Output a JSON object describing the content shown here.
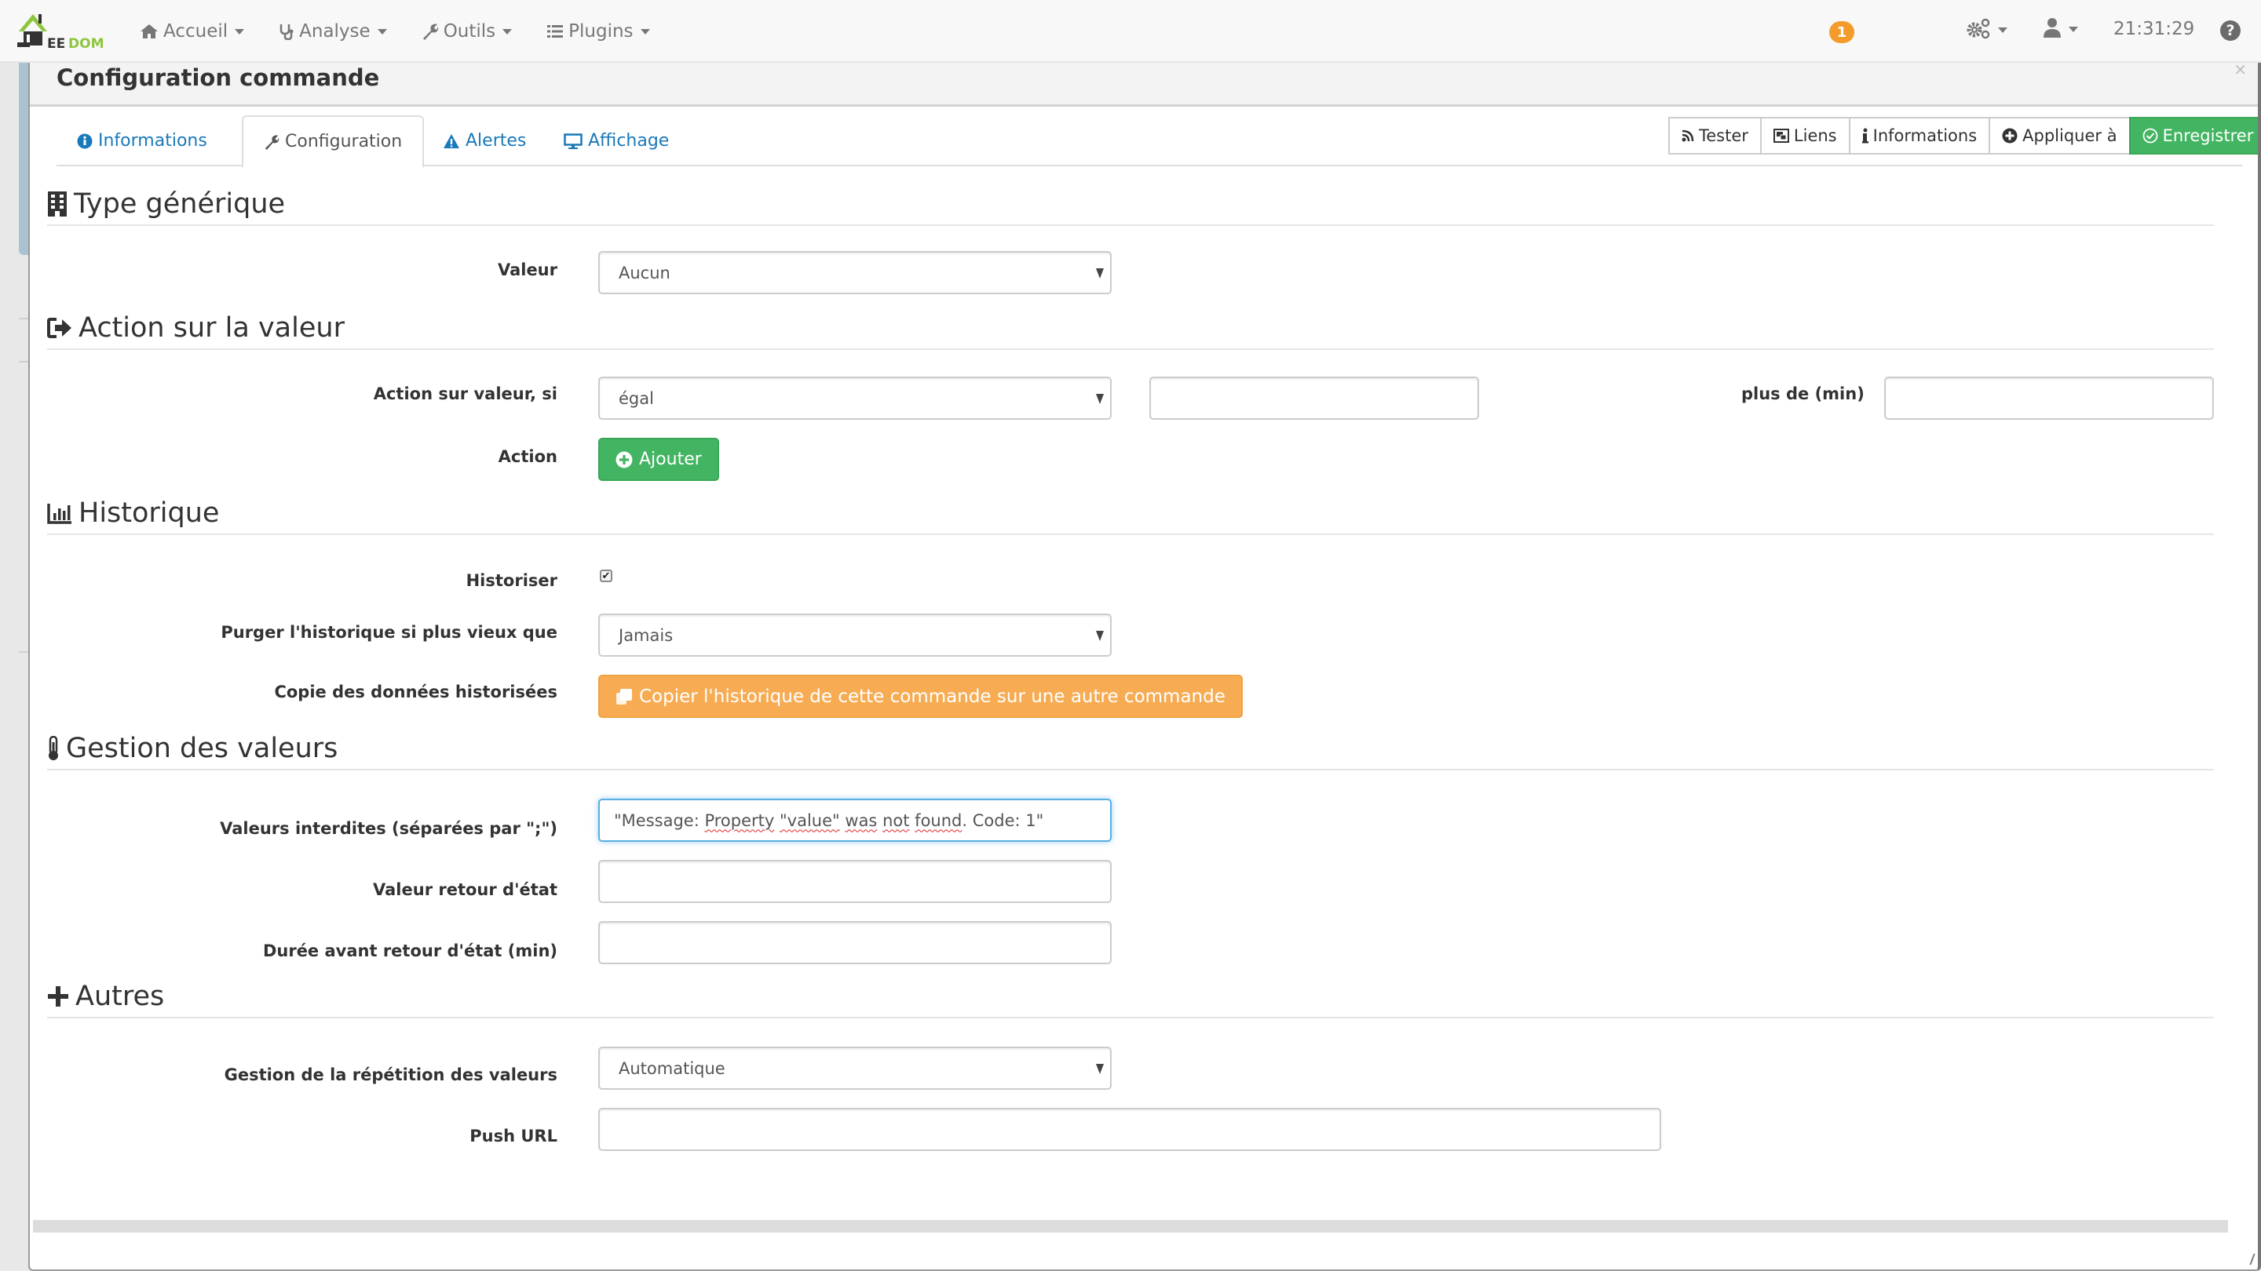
{
  "navbar": {
    "brand": "JEEDOM",
    "menu": [
      {
        "label": "Accueil",
        "icon": "home-icon"
      },
      {
        "label": "Analyse",
        "icon": "stethoscope-icon"
      },
      {
        "label": "Outils",
        "icon": "wrench-icon"
      },
      {
        "label": "Plugins",
        "icon": "tasks-icon"
      }
    ],
    "notification_count": "1",
    "clock": "21:31:29",
    "help_label": "?"
  },
  "modal": {
    "title": "Configuration commande",
    "tabs": [
      {
        "label": "Informations",
        "icon": "info-circle-icon",
        "active": false
      },
      {
        "label": "Configuration",
        "icon": "wrench-icon",
        "active": true
      },
      {
        "label": "Alertes",
        "icon": "warning-icon",
        "active": false
      },
      {
        "label": "Affichage",
        "icon": "desktop-icon",
        "active": false
      }
    ],
    "actions": [
      {
        "label": "Tester",
        "icon": "rss-icon"
      },
      {
        "label": "Liens",
        "icon": "object-group-icon"
      },
      {
        "label": "Informations",
        "icon": "info-icon"
      },
      {
        "label": "Appliquer à",
        "icon": "plus-circle-icon"
      },
      {
        "label": "Enregistrer",
        "icon": "check-circle-icon"
      }
    ]
  },
  "sections": {
    "type_generique": {
      "title": "Type générique",
      "valeur_label": "Valeur",
      "valeur_selected": "Aucun"
    },
    "action_valeur": {
      "title": "Action sur la valeur",
      "condition_label": "Action sur valeur, si",
      "condition_selected": "égal",
      "condition_value": "",
      "duration_label": "plus de (min)",
      "duration_value": "",
      "action_label": "Action",
      "add_button": "Ajouter"
    },
    "historique": {
      "title": "Historique",
      "historiser_label": "Historiser",
      "historiser_checked": true,
      "purge_label": "Purger l'historique si plus vieux que",
      "purge_selected": "Jamais",
      "copy_label": "Copie des données historisées",
      "copy_button": "Copier l'historique de cette commande sur une autre commande"
    },
    "gestion_valeurs": {
      "title": "Gestion des valeurs",
      "forbidden_label": "Valeurs interdites (séparées par \";\")",
      "forbidden_value_parts": [
        "\"Message: ",
        "Property",
        " ",
        "\"value\"",
        " ",
        "was",
        " ",
        "not",
        " ",
        "found",
        ". Code: 1\""
      ],
      "return_state_label": "Valeur retour d'état",
      "return_state_value": "",
      "return_delay_label": "Durée avant retour d'état (min)",
      "return_delay_value": ""
    },
    "autres": {
      "title": "Autres",
      "repeat_label": "Gestion de la répétition des valeurs",
      "repeat_selected": "Automatique",
      "push_url_label": "Push URL",
      "push_url_value": ""
    }
  },
  "colors": {
    "success": "#43b562",
    "warning": "#f7ac54",
    "link": "#1a79b8",
    "badge": "#f39c2b",
    "brand_green": "#8dc63f"
  }
}
